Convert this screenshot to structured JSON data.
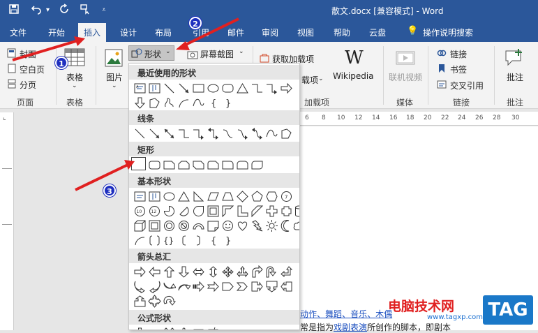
{
  "window": {
    "title": "散文.docx [兼容模式] - Word"
  },
  "tabs": [
    {
      "label": "文件"
    },
    {
      "label": "开始"
    },
    {
      "label": "插入"
    },
    {
      "label": "设计"
    },
    {
      "label": "布局"
    },
    {
      "label": "引用"
    },
    {
      "label": "邮件"
    },
    {
      "label": "审阅"
    },
    {
      "label": "视图"
    },
    {
      "label": "帮助"
    },
    {
      "label": "云盘"
    },
    {
      "label": "操作说明搜索"
    }
  ],
  "ribbon": {
    "pages": {
      "cover": "封面",
      "blank": "空白页",
      "break": "分页",
      "group": "页面"
    },
    "table": {
      "label": "表格",
      "group": "表格"
    },
    "picture": {
      "label": "图片"
    },
    "shapes": {
      "label": "形状"
    },
    "screenshot": {
      "label": "屏幕截图"
    },
    "addins": {
      "get": "获取加载项",
      "my": "载项",
      "group": "加载项"
    },
    "wikipedia": {
      "label": "Wikipedia"
    },
    "media": {
      "online_video": "联机视频",
      "group": "媒体"
    },
    "links": {
      "link": "链接",
      "bookmark": "书签",
      "crossref": "交叉引用",
      "group": "链接"
    },
    "comments": {
      "label": "批注",
      "group": "批注"
    }
  },
  "shapes_menu": {
    "sections": [
      {
        "title": "最近使用的形状"
      },
      {
        "title": "线条"
      },
      {
        "title": "矩形"
      },
      {
        "title": "基本形状"
      },
      {
        "title": "箭头总汇"
      },
      {
        "title": "公式形状"
      }
    ]
  },
  "ruler": {
    "numbers": [
      "6",
      "8",
      "10",
      "12",
      "14",
      "16",
      "18",
      "20",
      "22",
      "24",
      "26",
      "28",
      "30"
    ]
  },
  "document": {
    "links": [
      "动作",
      "舞蹈",
      "音乐",
      "木偶"
    ],
    "line2_a": "常是指为",
    "line2_link": "戏剧表演",
    "line2_b": "所创作的脚本，即剧本"
  },
  "annotations": {
    "badge1": "1",
    "badge2": "2",
    "badge3": "3"
  },
  "watermark": {
    "text": "电脑技术网",
    "url": "www.tagxp.com",
    "tag": "TAG"
  },
  "colors": {
    "brand": "#2b579a",
    "annotation_red": "#e02020",
    "badge_blue": "#1f2fbf"
  }
}
